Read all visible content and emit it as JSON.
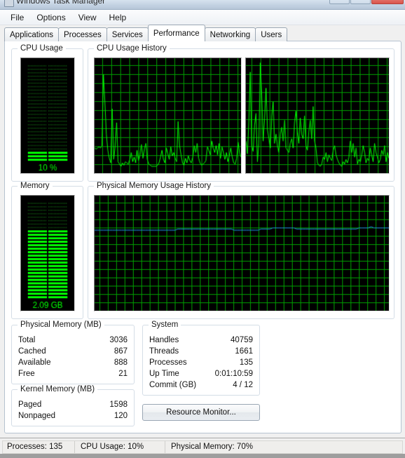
{
  "window": {
    "title": "Windows Task Manager",
    "icon": "task-manager-icon",
    "controls": {
      "minimize": "–",
      "maximize": "□",
      "close": "×"
    }
  },
  "menu": [
    {
      "label": "File"
    },
    {
      "label": "Options"
    },
    {
      "label": "View"
    },
    {
      "label": "Help"
    }
  ],
  "tabs": [
    {
      "label": "Applications",
      "active": false
    },
    {
      "label": "Processes",
      "active": false
    },
    {
      "label": "Services",
      "active": false
    },
    {
      "label": "Performance",
      "active": true
    },
    {
      "label": "Networking",
      "active": false
    },
    {
      "label": "Users",
      "active": false
    }
  ],
  "cpu_usage": {
    "legend": "CPU Usage",
    "value_label": "10 %",
    "percent": 10
  },
  "memory_gauge": {
    "legend": "Memory",
    "value_label": "2.09 GB",
    "percent": 70
  },
  "cpu_history": {
    "legend": "CPU Usage History"
  },
  "memory_history": {
    "legend": "Physical Memory Usage History"
  },
  "physical_memory": {
    "legend": "Physical Memory (MB)",
    "rows": [
      {
        "key": "Total",
        "value": "3036"
      },
      {
        "key": "Cached",
        "value": "867"
      },
      {
        "key": "Available",
        "value": "888"
      },
      {
        "key": "Free",
        "value": "21"
      }
    ]
  },
  "kernel_memory": {
    "legend": "Kernel Memory (MB)",
    "rows": [
      {
        "key": "Paged",
        "value": "1598"
      },
      {
        "key": "Nonpaged",
        "value": "120"
      }
    ]
  },
  "system": {
    "legend": "System",
    "rows": [
      {
        "key": "Handles",
        "value": "40759"
      },
      {
        "key": "Threads",
        "value": "1661"
      },
      {
        "key": "Processes",
        "value": "135"
      },
      {
        "key": "Up Time",
        "value": "0:01:10:59"
      },
      {
        "key": "Commit (GB)",
        "value": "4 / 12"
      }
    ]
  },
  "resource_monitor_button": {
    "label": "Resource Monitor..."
  },
  "statusbar": {
    "processes": "Processes: 135",
    "cpu_usage": "CPU Usage: 10%",
    "physical_memory": "Physical Memory: 70%"
  },
  "colors": {
    "graph_background": "#000000",
    "grid_line": "#00a000",
    "cpu_line": "#00ff00",
    "memory_line": "#2196f3",
    "meter_bar_on": "#00ff00",
    "meter_bar_off": "#0d4d0d",
    "value_text": "#00ff00"
  },
  "chart_data": [
    {
      "type": "line",
      "title": "CPU Usage History",
      "name": "cpu-core-0",
      "ylim": [
        0,
        100
      ],
      "grid": true,
      "values": [
        22,
        21,
        22,
        23,
        22,
        24,
        86,
        62,
        34,
        20,
        13,
        9,
        56,
        12,
        24,
        44,
        10,
        8,
        6,
        9,
        7,
        10,
        9,
        8,
        12,
        18,
        10,
        14,
        9,
        20,
        11,
        16,
        25,
        13,
        21,
        26,
        12,
        8,
        7,
        6,
        6,
        6,
        6,
        7,
        9,
        14,
        20,
        12,
        9,
        22,
        17,
        12,
        23,
        15,
        18,
        13,
        10,
        45,
        24,
        16,
        9,
        7,
        13,
        9,
        15,
        11,
        9,
        14,
        24,
        18,
        26,
        13,
        9,
        7,
        8,
        9,
        11,
        23,
        20,
        16,
        28,
        22,
        18,
        24,
        16,
        26,
        13,
        23,
        18,
        12,
        18,
        10,
        15,
        22,
        14,
        9,
        8,
        13,
        27,
        18,
        14
      ]
    },
    {
      "type": "line",
      "title": "CPU Usage History",
      "name": "cpu-core-1",
      "ylim": [
        0,
        100
      ],
      "grid": true,
      "values": [
        28,
        17,
        44,
        88,
        24,
        19,
        42,
        52,
        10,
        26,
        96,
        68,
        28,
        48,
        74,
        38,
        30,
        22,
        50,
        62,
        26,
        34,
        24,
        18,
        34,
        40,
        28,
        46,
        22,
        20,
        18,
        26,
        30,
        22,
        44,
        54,
        36,
        26,
        48,
        34,
        30,
        50,
        24,
        20,
        36,
        46,
        30,
        58,
        28,
        22,
        9,
        7,
        6,
        8,
        14,
        12,
        18,
        10,
        16,
        13,
        11,
        20,
        24,
        16,
        12,
        9,
        7,
        6,
        10,
        8,
        12,
        9,
        14,
        28,
        18,
        26,
        14,
        22,
        8,
        12,
        10,
        16,
        24,
        18,
        9,
        13,
        11,
        22,
        16,
        10,
        26,
        18,
        14,
        9,
        12,
        20,
        16,
        24,
        10,
        18,
        13
      ]
    },
    {
      "type": "line",
      "title": "Physical Memory Usage History",
      "name": "physical-memory",
      "ylim": [
        0,
        100
      ],
      "grid": true,
      "values": [
        70,
        70,
        70,
        70,
        70,
        70,
        70,
        70,
        70,
        70,
        70,
        70,
        70,
        70,
        70,
        70,
        70,
        70,
        70,
        70,
        70,
        70,
        70,
        70,
        70,
        70,
        70,
        70,
        71,
        71,
        71,
        71,
        71,
        71,
        71,
        71,
        71,
        71,
        71,
        71,
        71,
        71,
        71,
        71,
        71,
        71,
        71,
        70,
        70,
        70,
        70,
        70,
        70,
        70,
        70,
        70,
        71,
        71,
        71,
        71,
        72,
        72,
        72,
        72,
        72,
        72,
        72,
        72,
        71,
        71,
        71,
        71,
        71,
        71,
        71,
        71,
        71,
        71,
        71,
        71,
        71,
        71,
        71,
        71,
        71,
        71,
        71,
        71,
        71,
        72,
        72,
        72,
        72,
        73,
        72,
        72,
        72,
        72,
        72,
        72
      ]
    }
  ]
}
